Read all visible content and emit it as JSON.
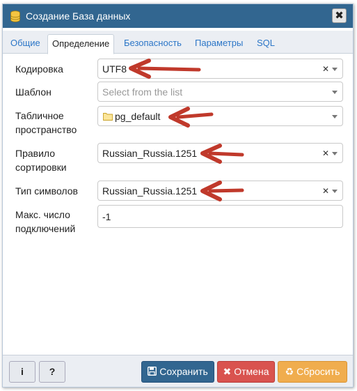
{
  "window": {
    "title": "Создание База данных",
    "close_label": "✖"
  },
  "tabs": [
    {
      "label": "Общие",
      "active": false
    },
    {
      "label": "Определение",
      "active": true
    },
    {
      "label": "Безопасность",
      "active": false
    },
    {
      "label": "Параметры",
      "active": false
    },
    {
      "label": "SQL",
      "active": false
    }
  ],
  "form": {
    "encoding": {
      "label": "Кодировка",
      "value": "UTF8"
    },
    "template": {
      "label": "Шаблон",
      "placeholder": "Select from the list"
    },
    "tablespace": {
      "label_line1": "Табличное",
      "label_line2": "пространство",
      "value": "pg_default"
    },
    "collation": {
      "label_line1": "Правило",
      "label_line2": "сортировки",
      "value": "Russian_Russia.1251"
    },
    "ctype": {
      "label": "Тип символов",
      "value": "Russian_Russia.1251"
    },
    "connlimit": {
      "label_line1": "Макс. число",
      "label_line2": "подключений",
      "value": "-1"
    }
  },
  "footer": {
    "info_label": "i",
    "help_label": "?",
    "save_label": "Сохранить",
    "cancel_label": "Отмена",
    "reset_label": "Сбросить"
  },
  "colors": {
    "titlebar": "#326690",
    "save": "#326690",
    "cancel": "#d9534f",
    "reset": "#f0ad4e",
    "annotation_arrow": "#c0392b"
  }
}
